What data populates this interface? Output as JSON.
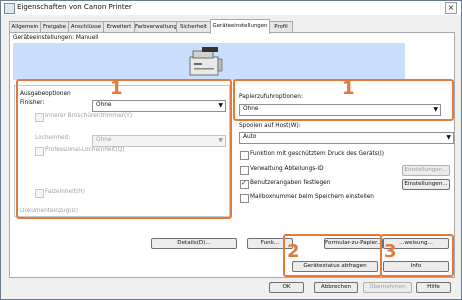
{
  "window": {
    "title": "Eigenschaften von Canon Printer",
    "close_label": "×"
  },
  "tabs": [
    {
      "label": "Allgemein"
    },
    {
      "label": "Freigabe"
    },
    {
      "label": "Anschlüsse"
    },
    {
      "label": "Erweitert"
    },
    {
      "label": "Farbverwaltung"
    },
    {
      "label": "Sicherheit"
    },
    {
      "label": "Geräteeinstellungen"
    },
    {
      "label": "Profil"
    }
  ],
  "active_tab": "Geräteeinstellungen",
  "panel": {
    "device_settings_label": "Geräteeinstellungen: Manuell",
    "output_options": {
      "title": "Ausgabeoptionen",
      "finisher_label": "Finisher:",
      "finisher_value": "Ohne",
      "inner_trimmer": "Innerer Broschürentrimmer(Y)",
      "punch_label": "Locheinheit:",
      "punch_value": "Ohne",
      "pro_punch": "Professional-Locheinheit(Q)",
      "folding_unit": "Falzeinheit(H)",
      "document_insert": "Dokumenteinzug(U)"
    },
    "paper_options": {
      "title": "Papierzufuhroptionen:",
      "value": "Ohne"
    },
    "spool": {
      "label": "Spoolen auf Host(W):",
      "value": "Auto"
    },
    "checks": [
      {
        "label": "Funktion mit geschütztem Druck des Geräts(I)",
        "checked": false
      },
      {
        "label": "Verwaltung Abteilungs-ID",
        "checked": false
      },
      {
        "label": "Benutzerangaben festlegen",
        "checked": true
      },
      {
        "label": "Mailboxnummer beim Speichern einstellen",
        "checked": false
      }
    ],
    "settings_btn_1": "Einstellungen...",
    "settings_btn_2": "Einstellungen...",
    "details_btn": "Details(D)...",
    "funk_btn": "Funk...",
    "form_btn": "Formular-zu-Papier...",
    "form2_btn": "...weisung...",
    "status_btn": "Gerätestatus abfragen",
    "info_btn": "Info"
  },
  "annotations": {
    "n1": "1",
    "n2": "2",
    "n3": "3"
  },
  "footer": {
    "ok": "OK",
    "cancel": "Abbrechen",
    "apply": "Übernehmen",
    "help": "Hilfe"
  }
}
